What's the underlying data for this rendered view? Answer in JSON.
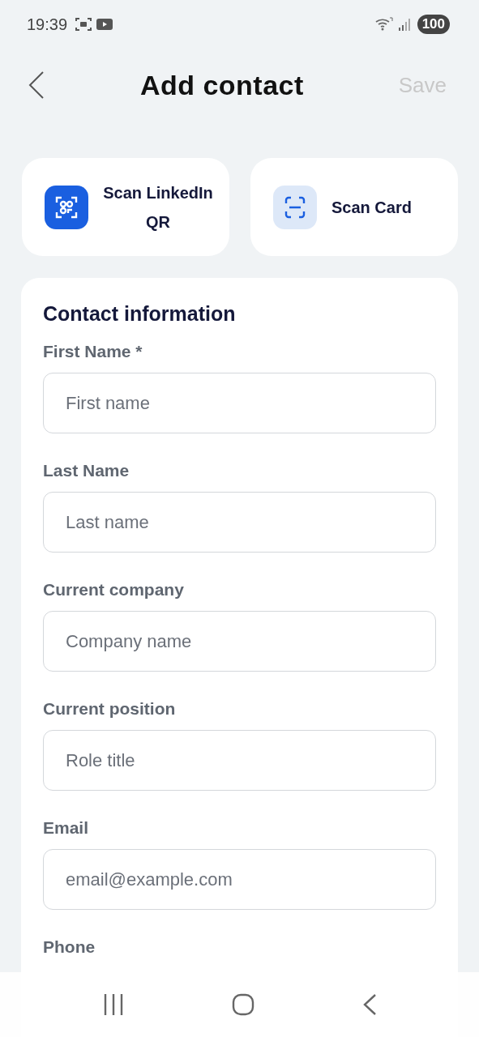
{
  "status_bar": {
    "time": "19:39",
    "battery": "100"
  },
  "header": {
    "title": "Add contact",
    "save": {
      "label": "Save",
      "disabled": true
    }
  },
  "scan_options": [
    {
      "kind": "qr",
      "label": "Scan LinkedIn QR"
    },
    {
      "kind": "card",
      "label": "Scan Card"
    }
  ],
  "form": {
    "title": "Contact information",
    "fields": [
      {
        "label": "First Name *",
        "placeholder": "First name"
      },
      {
        "label": "Last Name",
        "placeholder": "Last name"
      },
      {
        "label": "Current company",
        "placeholder": "Company name"
      },
      {
        "label": "Current position",
        "placeholder": "Role title"
      },
      {
        "label": "Email",
        "placeholder": "email@example.com"
      },
      {
        "label": "Phone"
      }
    ]
  }
}
